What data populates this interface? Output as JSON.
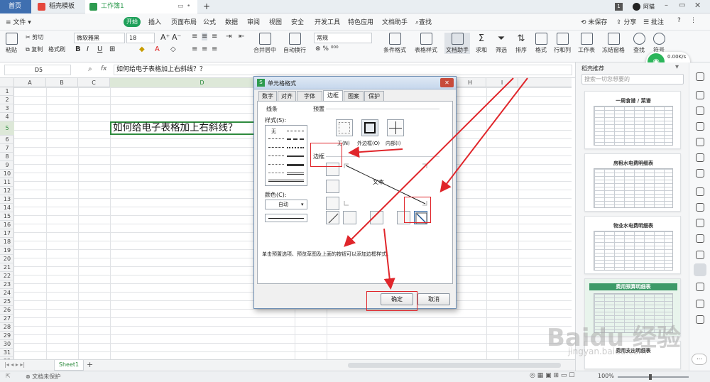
{
  "tabs": {
    "home": "首页",
    "template": "稻壳模板",
    "workbook": "工作簿1",
    "add": "+"
  },
  "tabbar_right": {
    "page_num": "1",
    "user": "阿猫"
  },
  "menu": {
    "file": "文件",
    "start": "开始",
    "items": [
      "插入",
      "页面布局",
      "公式",
      "数据",
      "审阅",
      "视图",
      "安全",
      "开发工具",
      "特色应用",
      "文档助手"
    ],
    "search": "查找",
    "unsaved": "未保存",
    "share": "分享",
    "comment": "批注"
  },
  "ribbon": {
    "paste": "粘贴",
    "cut": "剪切",
    "copy": "复制",
    "format_painter": "格式刷",
    "font": "微软雅黑",
    "size": "18",
    "merge": "合并居中",
    "wrap": "自动换行",
    "numfmt": "常规",
    "cond_fmt": "条件格式",
    "table_style": "表格样式",
    "doc_helper": "文档助手",
    "sum": "求和",
    "filter": "筛选",
    "sort": "排序",
    "format": "格式",
    "rowcol": "行和列",
    "sheet": "工作表",
    "freeze": "冻结窗格",
    "find": "查找",
    "symbol": "符号"
  },
  "formula": {
    "cell_ref": "D5",
    "fx": "fx",
    "content": "如何给电子表格加上右斜线？？"
  },
  "columns": [
    "A",
    "B",
    "C",
    "D",
    "E",
    "F",
    "G",
    "H",
    "I"
  ],
  "rows": [
    "1",
    "2",
    "3",
    "4",
    "5",
    "6",
    "7",
    "8",
    "9",
    "10",
    "11",
    "12",
    "13",
    "14",
    "15",
    "16",
    "17",
    "18",
    "19",
    "20",
    "21",
    "22",
    "23",
    "24",
    "25",
    "26",
    "27",
    "28",
    "29",
    "30",
    "31",
    "32"
  ],
  "cell_text": "如何给电子表格加上右斜线？",
  "sheet": {
    "name": "Sheet1",
    "add": "+"
  },
  "status": {
    "protect": "文档未保护",
    "zoom": "100%"
  },
  "panel": {
    "title": "稻壳推荐",
    "search_placeholder": "搜索一切您想要的",
    "cards": [
      "一周食谱 / 菜谱",
      "房租水电费明细表",
      "物业水电费明细表",
      "费用预算明细表",
      "费用支出明细表"
    ]
  },
  "speed": {
    "up": "0.00K/s",
    "down": "0"
  },
  "dialog": {
    "title": "单元格格式",
    "tabs": [
      "数字",
      "对齐",
      "字体",
      "边框",
      "图案",
      "保护"
    ],
    "line_label": "线条",
    "style_label": "样式(S):",
    "none_label": "无",
    "color_label": "颜色(C):",
    "color_value": "自动",
    "preset_label": "预置",
    "preset_none": "无(N)",
    "preset_outer": "外边框(O)",
    "preset_inner": "内部(I)",
    "border_label": "边框",
    "preview_text": "文本",
    "hint": "单击预置选项、预览草图及上面的按钮可以添加边框样式。",
    "ok": "确定",
    "cancel": "取消"
  },
  "watermark": "Baidu 经验",
  "watermark_url": "jingyan.baidu.com",
  "colors": {
    "accent_green": "#1fa05a",
    "annotation_red": "#e0262b",
    "sheet_tab_green": "#2e8b3e"
  }
}
